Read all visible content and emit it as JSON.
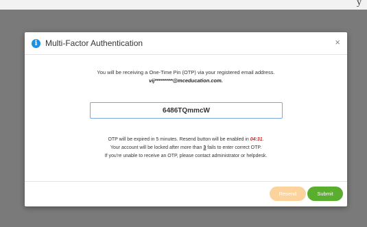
{
  "background": {
    "corner_fragment": "y"
  },
  "dialog": {
    "title": "Multi-Factor Authentication",
    "close_glyph": "×",
    "icon": "info-icon",
    "message_line1": "You will be receiving a One-Time Pin (OTP) via your registered email address.",
    "masked_email": "vij*********@mceducation.com.",
    "otp_value": "6486TQmmcW",
    "expiry_prefix": "OTP will be expired in 5 minutes. Resend button will be enabled in ",
    "countdown": "04:31",
    "expiry_suffix": ".",
    "lock_prefix": "Your account will be locked after more than ",
    "fail_count": "3",
    "lock_suffix": " fails to enter correct OTP.",
    "help_line": "If you're unable to receive an OTP, please contact administrator or helpdesk.",
    "resend_label": "Resend",
    "submit_label": "Submit"
  },
  "colors": {
    "accent_blue": "#1e8fe1",
    "countdown_red": "#d9231c",
    "resend_disabled": "#fcd39c",
    "submit_green": "#5aae2e",
    "backdrop": "#7b7b7b"
  }
}
